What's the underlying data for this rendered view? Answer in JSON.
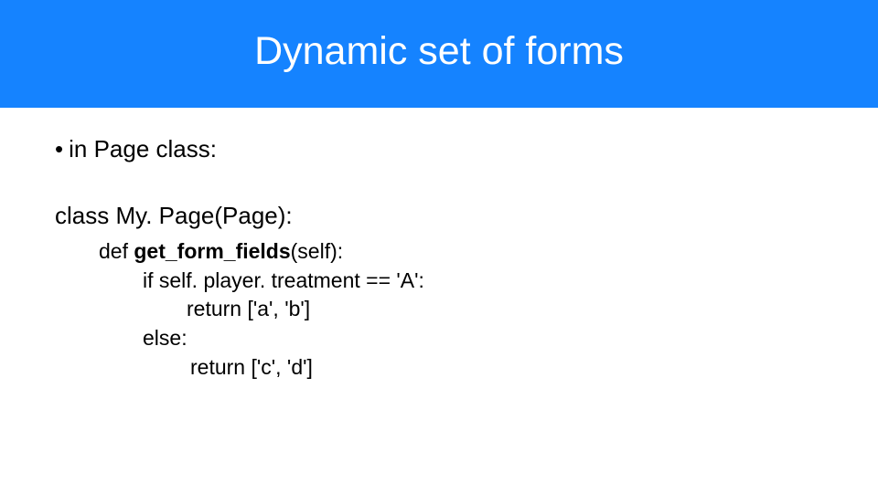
{
  "header": {
    "title": "Dynamic set of forms"
  },
  "bullet": {
    "dot": "•",
    "text": "in Page class:"
  },
  "code": {
    "class_line": "class My. Page(Page):",
    "def_prefix": "def ",
    "def_method": "get_form_fields",
    "def_suffix": "(self):",
    "if_line": "if self. player. treatment == 'A':",
    "return_a": "return ['a', 'b']",
    "else_line": "else:",
    "return_c": "return ['c', 'd']"
  }
}
